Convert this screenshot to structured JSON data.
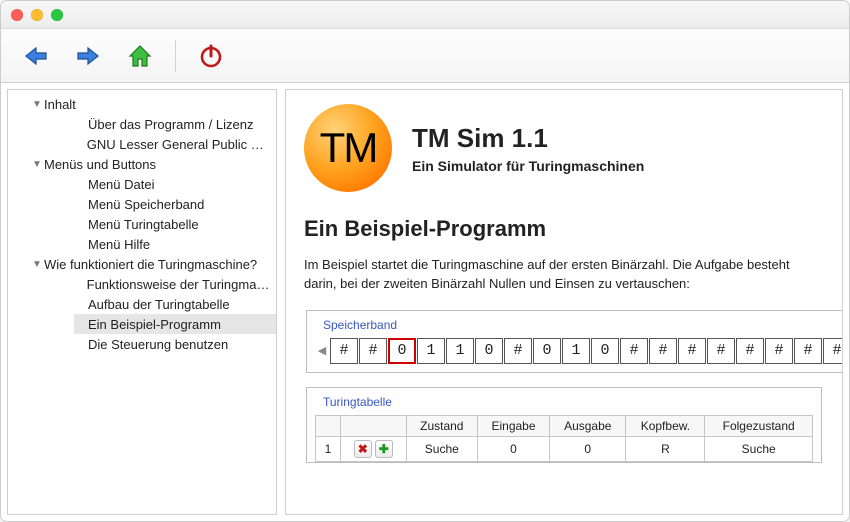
{
  "toolbar": {
    "back": "Back",
    "forward": "Forward",
    "home": "Home",
    "power": "Power"
  },
  "tree": {
    "n0": "Inhalt",
    "n0a": "Über das Programm / Lizenz",
    "n0b": "GNU Lesser General Public Lice…",
    "n1": "Menüs und Buttons",
    "n1a": "Menü Datei",
    "n1b": "Menü Speicherband",
    "n1c": "Menü Turingtabelle",
    "n1d": "Menü Hilfe",
    "n2": "Wie funktioniert die Turingmaschine?",
    "n2a": "Funktionsweise der Turingmasch…",
    "n2b": "Aufbau der Turingtabelle",
    "n2c": "Ein Beispiel-Programm",
    "n2d": "Die Steuerung benutzen"
  },
  "help": {
    "logo_text": "TM",
    "title": "TM Sim 1.1",
    "subtitle": "Ein Simulator für Turingmaschinen",
    "h2": "Ein Beispiel-Programm",
    "para": "Im Beispiel startet die Turingmaschine auf der ersten Binärzahl. Die Aufgabe besteht darin, bei der zweiten Binärzahl Nullen und Einsen zu vertauschen:",
    "tape_legend": "Speicherband",
    "tape": [
      "#",
      "#",
      "0",
      "1",
      "1",
      "0",
      "#",
      "0",
      "1",
      "0",
      "#",
      "#",
      "#",
      "#",
      "#",
      "#",
      "#",
      "#",
      "#",
      "#"
    ],
    "head_index": 2,
    "tt_legend": "Turingtabelle",
    "tt_headers": [
      "",
      "",
      "Zustand",
      "Eingabe",
      "Ausgabe",
      "Kopfbew.",
      "Folgezustand"
    ],
    "tt_row": {
      "idx": "1",
      "zustand": "Suche",
      "eingabe": "0",
      "ausgabe": "0",
      "kopf": "R",
      "folge": "Suche"
    }
  }
}
